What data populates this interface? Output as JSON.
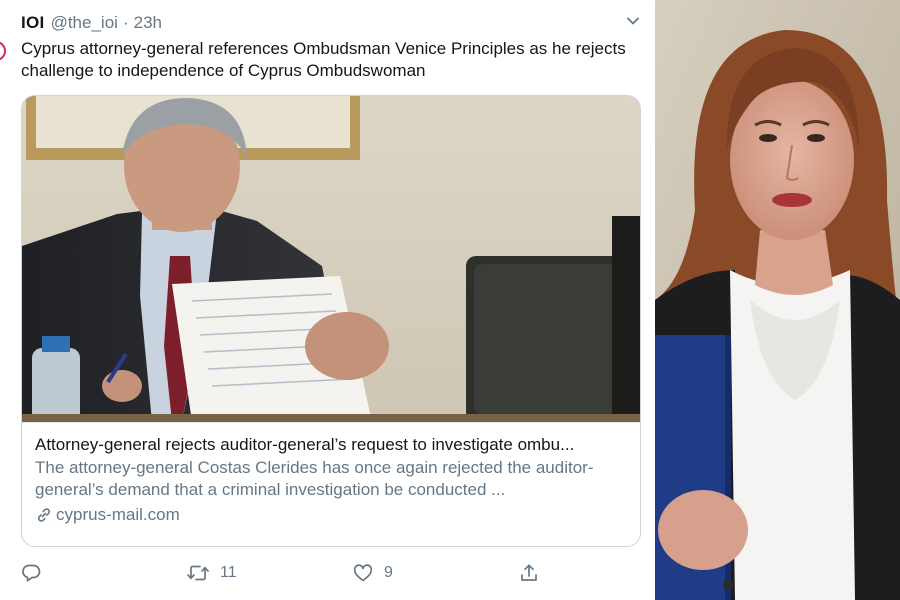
{
  "tweet": {
    "author_name": "IOI",
    "author_handle": "@the_ioi",
    "separator": "·",
    "timestamp": "23h",
    "text": "Cyprus attorney-general references Ombudsman Venice Principles as he rejects challenge to independence of Cyprus Ombudswoman"
  },
  "card": {
    "image_icon": "photo-man-reading-documents",
    "title": "Attorney-general rejects auditor-general’s request to investigate ombu...",
    "description": "The attorney-general Costas Clerides has once again rejected the auditor-general’s demand that a criminal investigation be conducted ...",
    "domain": "cyprus-mail.com",
    "domain_icon": "link-icon"
  },
  "actions": {
    "reply_icon": "reply-icon",
    "retweet_icon": "retweet-icon",
    "retweet_count": "11",
    "like_icon": "heart-icon",
    "like_count": "9",
    "share_icon": "share-icon"
  },
  "side_photo": {
    "icon": "photo-woman-portrait"
  },
  "colors": {
    "text_primary": "#14171a",
    "text_secondary": "#657786",
    "border": "#ccd6dd",
    "background": "#ffffff"
  }
}
